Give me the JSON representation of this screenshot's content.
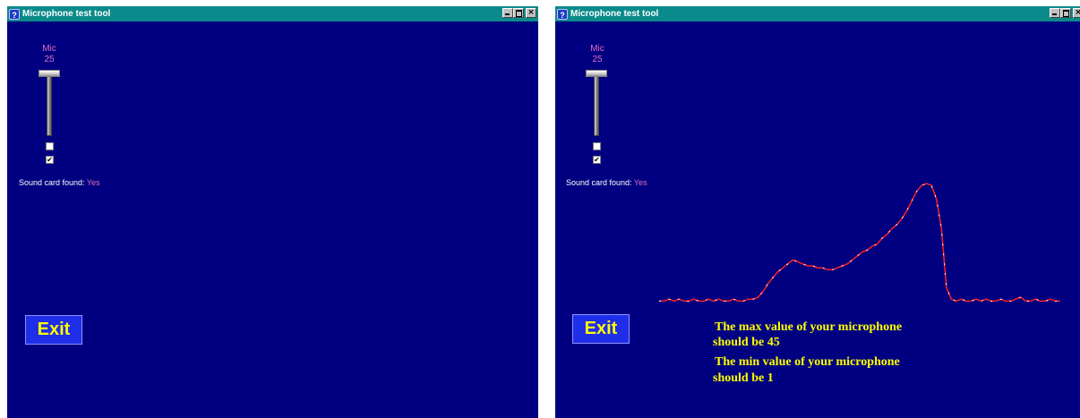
{
  "left_window": {
    "title": "Microphone test tool",
    "mic_label": "Mic",
    "mic_value": "25",
    "checkbox1_checked": false,
    "checkbox2_checked": true,
    "sound_card_label": "Sound card found:",
    "sound_card_value": "Yes",
    "exit_label": "Exit"
  },
  "right_window": {
    "title": "Microphone test tool",
    "mic_label": "Mic",
    "mic_value": "25",
    "checkbox1_checked": false,
    "checkbox2_checked": true,
    "sound_card_label": "Sound card found:",
    "sound_card_value": "Yes",
    "exit_label": "Exit",
    "result_line1": "The max value of your microphone",
    "result_line2": "should be  45",
    "result_line3": "The min value of your microphone",
    "result_line4": "should be   1"
  },
  "waveform": {
    "color_line": "#ff2020",
    "color_highlight": "#ffffff",
    "samples": [
      3,
      3,
      4,
      3,
      4,
      3,
      3,
      4,
      3,
      3,
      4,
      3,
      4,
      3,
      3,
      4,
      3,
      3,
      4,
      4,
      5,
      8,
      12,
      15,
      18,
      20,
      22,
      24,
      23,
      22,
      21,
      21,
      20,
      20,
      19,
      19,
      20,
      21,
      22,
      24,
      26,
      28,
      29,
      31,
      32,
      35,
      37,
      40,
      42,
      45,
      49,
      54,
      59,
      62,
      63,
      62,
      55,
      40,
      10,
      4,
      3,
      4,
      3,
      3,
      4,
      3,
      4,
      3,
      3,
      4,
      3,
      3,
      4,
      5,
      3,
      3,
      4,
      3,
      3,
      4,
      3,
      3
    ],
    "max": 45,
    "min": 1
  },
  "colors": {
    "window_bg": "#000080",
    "titlebar": "#0a8a8a",
    "accent_text": "#e070c0",
    "exit_bg": "#1f2ee8",
    "exit_text": "#ffff00",
    "result_text": "#ffff00"
  }
}
